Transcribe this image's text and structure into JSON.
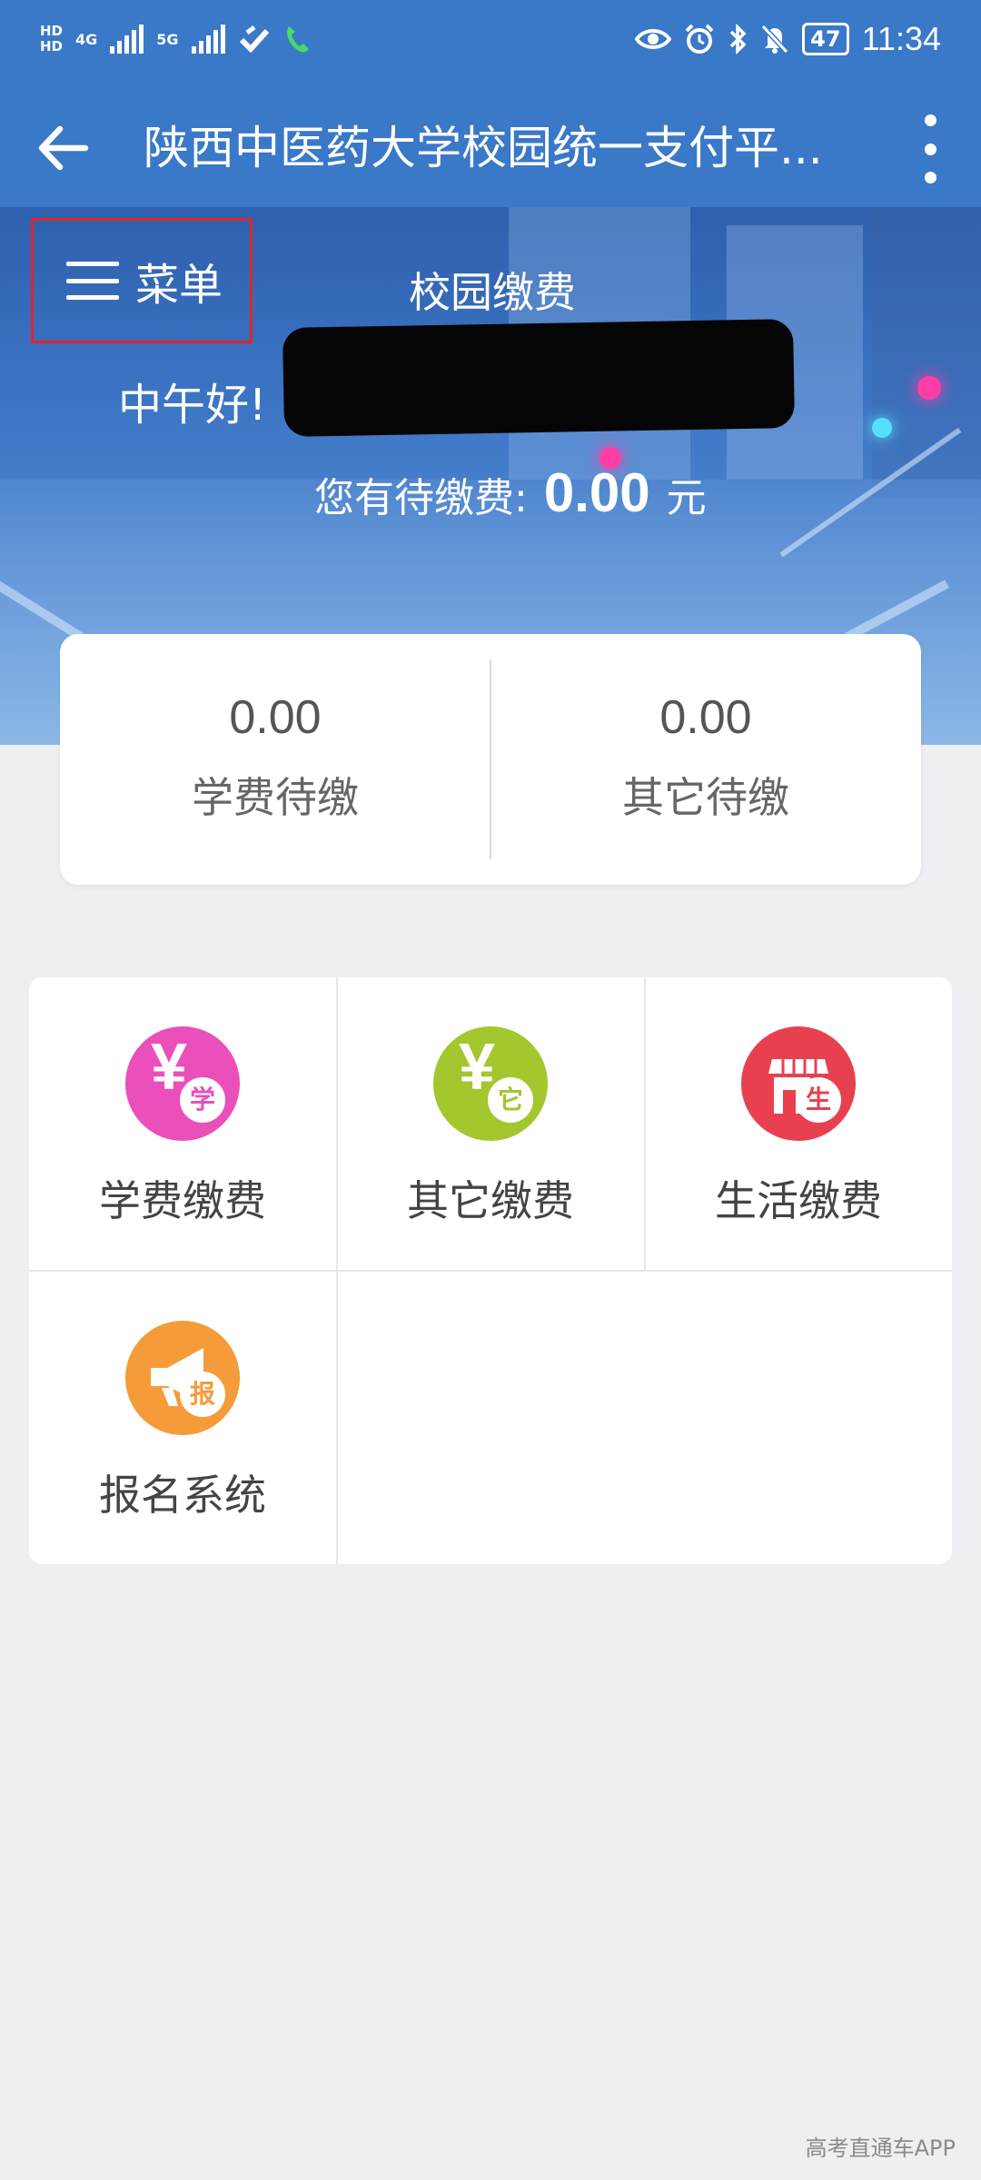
{
  "status_bar": {
    "hd1": "HD",
    "hd2": "HD",
    "sim1_net": "4G",
    "sim2_net": "5G",
    "battery": "47",
    "time": "11:34"
  },
  "app_bar": {
    "title": "陕西中医药大学校园统一支付平..."
  },
  "hero": {
    "menu_label": "菜单",
    "title": "校园缴费",
    "greeting": "中午好!",
    "due_label": "您有待缴费:",
    "due_amount": "0.00",
    "due_unit": "元"
  },
  "summary": {
    "tuition": {
      "value": "0.00",
      "label": "学费待缴"
    },
    "other": {
      "value": "0.00",
      "label": "其它待缴"
    }
  },
  "services": [
    {
      "label": "学费缴费",
      "icon": "tuition-payment-icon",
      "badge": "学",
      "color": "#ea4fba"
    },
    {
      "label": "其它缴费",
      "icon": "other-payment-icon",
      "badge": "它",
      "color": "#a3c72d"
    },
    {
      "label": "生活缴费",
      "icon": "living-payment-icon",
      "badge": "生",
      "color": "#e8404f"
    },
    {
      "label": "报名系统",
      "icon": "registration-icon",
      "badge": "报",
      "color": "#f59b3a"
    }
  ],
  "watermark": "高考直通车APP",
  "colors": {
    "header_blue": "#3a78c8",
    "page_bg": "#eeeff3",
    "highlight_box": "#e0262a"
  }
}
